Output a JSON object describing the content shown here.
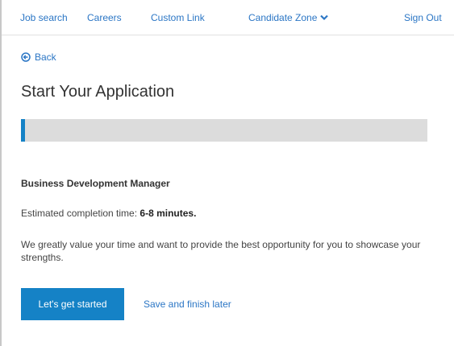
{
  "nav": {
    "job_search": "Job search",
    "careers": "Careers",
    "custom_link": "Custom Link",
    "candidate_zone": "Candidate Zone",
    "sign_out": "Sign Out"
  },
  "back_label": "Back",
  "page_title": "Start Your Application",
  "progress": {
    "value_percent": 1
  },
  "job_title": "Business Development Manager",
  "estimate": {
    "label": "Estimated completion time:",
    "value": "6-8 minutes."
  },
  "description": "We greatly value your time and want to provide the best opportunity for you to showcase your strengths.",
  "buttons": {
    "start": "Let's get started",
    "save_later": "Save and finish later"
  },
  "colors": {
    "accent": "#1582c6",
    "link": "#2b76c5",
    "progress_track": "#dcdcdc"
  },
  "icons": {
    "back": "back-circle-arrow-icon",
    "candidate_zone_dropdown": "chevron-down-icon"
  }
}
